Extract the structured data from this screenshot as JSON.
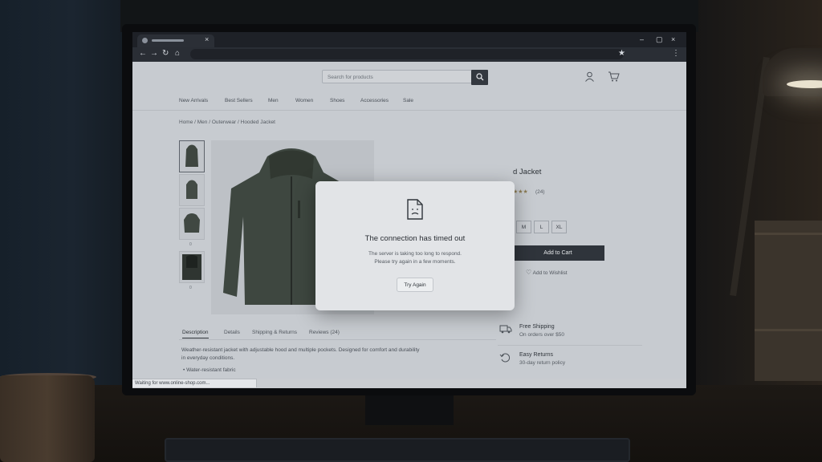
{
  "browser": {
    "tab_close": "×",
    "window_controls": [
      "–",
      "▢",
      "×"
    ],
    "nav": {
      "back": "←",
      "forward": "→",
      "reload": "↻",
      "home": "⌂",
      "bookmark": "★",
      "menu": "⋮"
    }
  },
  "site": {
    "search_placeholder": "Search for products",
    "menu": [
      "New Arrivals",
      "Best Sellers",
      "Men",
      "Women",
      "Shoes",
      "Accessories",
      "Sale"
    ],
    "breadcrumb": [
      "Home",
      "Men",
      "Outerwear",
      "Hooded Jacket"
    ],
    "thumb_label": "0",
    "product": {
      "title_visible": "d Jacket",
      "rating_stars": "★★★",
      "review_count": "(24)",
      "sizes": [
        "M",
        "L",
        "XL"
      ],
      "add_to_cart": "Add to Cart",
      "wishlist": "Add to Wishlist"
    },
    "tabs": [
      "Description",
      "Details",
      "Shipping & Returns",
      "Reviews (24)"
    ],
    "description": "Weather-resistant jacket with adjustable hood and multiple pockets. Designed for comfort and durability in everyday conditions.",
    "bullets": [
      "• Water-resistant fabric"
    ],
    "perks": [
      {
        "title": "Free Shipping",
        "subtitle": "On orders over $50",
        "icon": "truck-icon"
      },
      {
        "title": "Easy Returns",
        "subtitle": "30-day return policy",
        "icon": "return-icon"
      }
    ]
  },
  "status_bar": "Waiting for www.online-shop.com...",
  "modal": {
    "icon": "sad-document-icon",
    "title": "The connection has timed out",
    "message_lines": [
      "The server is taking too long to respond.",
      "Please try again in a few moments."
    ],
    "button": "Try Again"
  },
  "colors": {
    "button_dark": "#2f343b",
    "modal_bg": "#e2e4e7"
  }
}
